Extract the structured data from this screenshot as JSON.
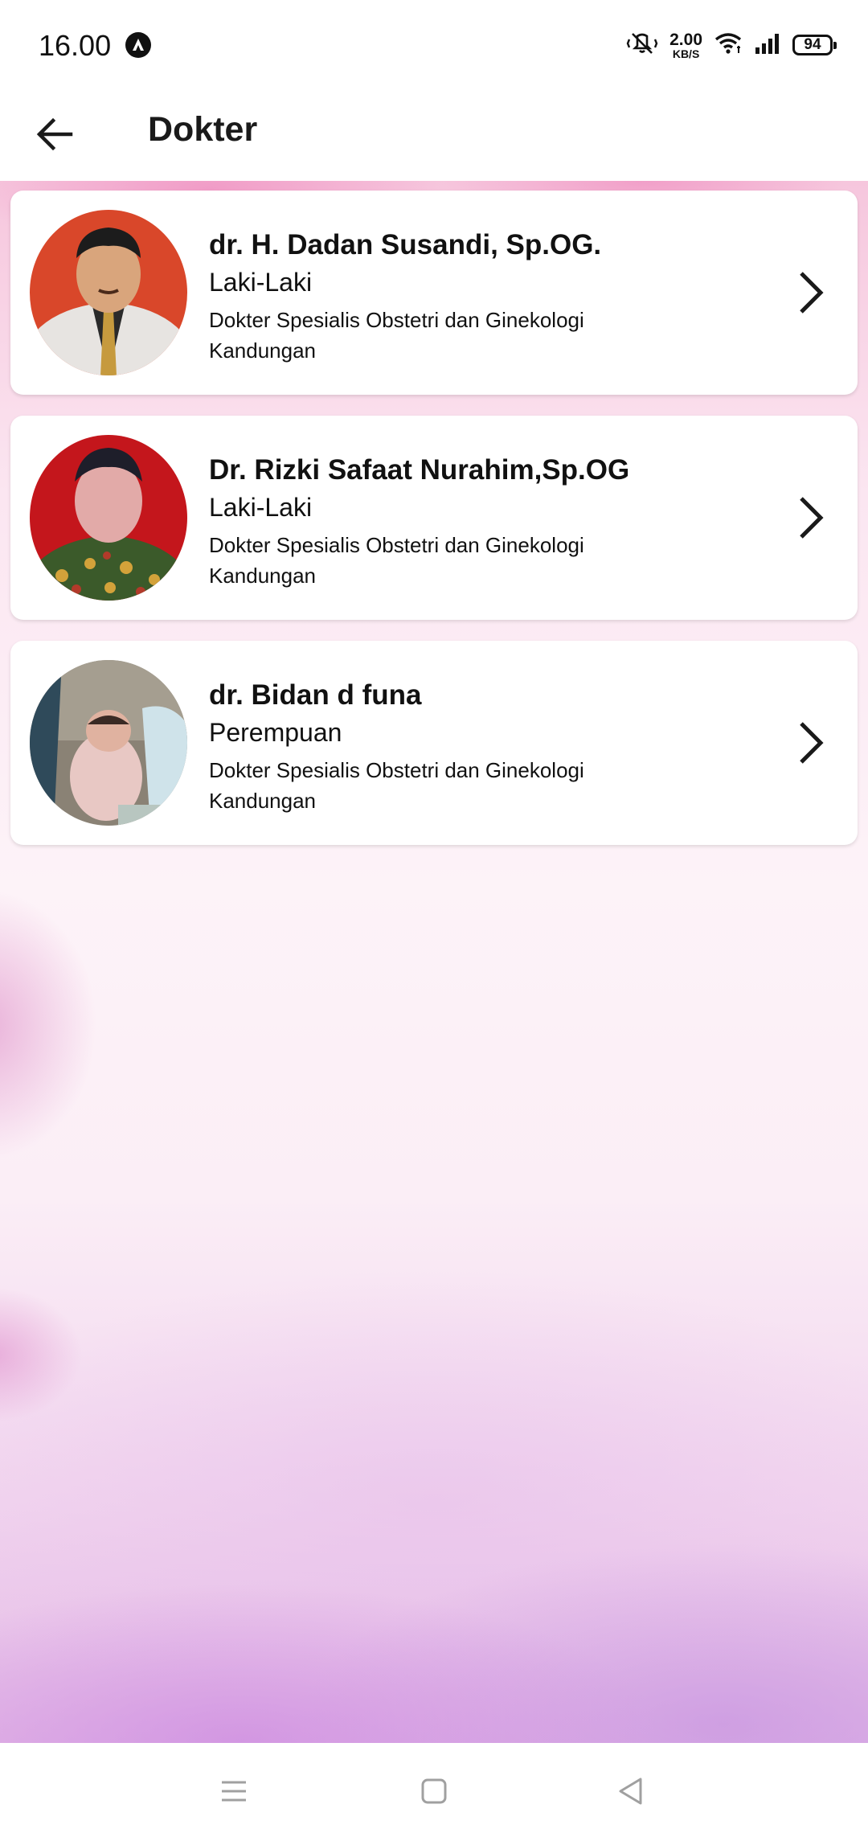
{
  "status_bar": {
    "time": "16.00",
    "speed_value": "2.00",
    "speed_unit": "KB/S",
    "battery": "94",
    "icons": [
      "app-notification-icon",
      "mute-vibrate-icon",
      "wifi-icon",
      "signal-icon",
      "battery-icon"
    ]
  },
  "app_bar": {
    "title": "Dokter",
    "back_icon": "arrow-left-icon"
  },
  "doctors": [
    {
      "name": "dr. H. Dadan Susandi, Sp.OG.",
      "gender": "Laki-Laki",
      "specialty": "Dokter Spesialis Obstetri dan Ginekologi Kandungan",
      "avatar_bg": "#d9472a"
    },
    {
      "name": "Dr. Rizki Safaat Nurahim,Sp.OG",
      "gender": "Laki-Laki",
      "specialty": "Dokter Spesialis Obstetri dan Ginekologi Kandungan",
      "avatar_bg": "#c4161c"
    },
    {
      "name": "dr. Bidan d funa",
      "gender": "Perempuan",
      "specialty": "Dokter Spesialis Obstetri dan Ginekologi Kandungan",
      "avatar_bg": "#8a8275"
    }
  ],
  "nav_bar": {
    "icons": [
      "menu-icon",
      "home-square-icon",
      "back-triangle-icon"
    ]
  },
  "colors": {
    "background_pink": "#fbe6f1",
    "background_purple": "#e3b8e6",
    "card": "#ffffff",
    "text": "#111111"
  }
}
